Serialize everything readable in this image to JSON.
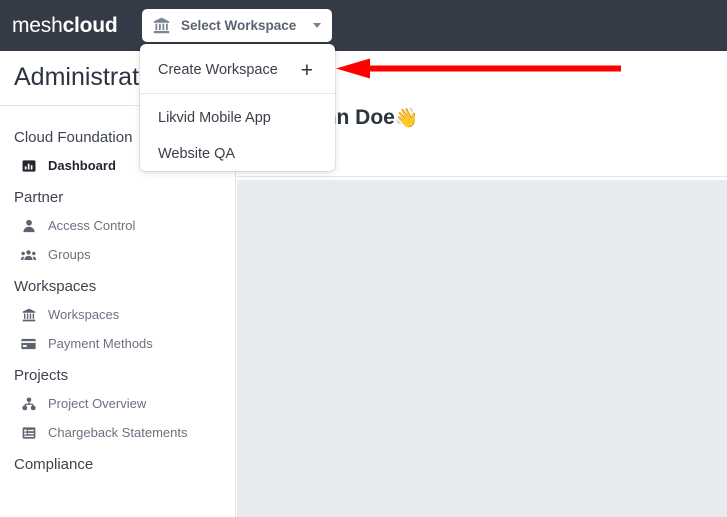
{
  "topbar": {
    "logo_primary": "mesh",
    "logo_secondary": "cloud",
    "workspace_selector": {
      "label": "Select Workspace",
      "icon": "bank-icon",
      "caret_icon": "chevron-down-icon"
    }
  },
  "workspace_dropdown": {
    "create_label": "Create Workspace",
    "create_icon": "plus-icon",
    "workspaces": [
      {
        "label": "Likvid Mobile App"
      },
      {
        "label": "Website QA"
      }
    ]
  },
  "sidebar": {
    "page_title": "Administration",
    "sections": [
      {
        "title": "Cloud Foundation",
        "items": [
          {
            "label": "Dashboard",
            "icon": "chart-bar-icon",
            "active": true
          }
        ]
      },
      {
        "title": "Partner",
        "items": [
          {
            "label": "Access Control",
            "icon": "user-icon",
            "active": false
          },
          {
            "label": "Groups",
            "icon": "users-group-icon",
            "active": false
          }
        ]
      },
      {
        "title": "Workspaces",
        "items": [
          {
            "label": "Workspaces",
            "icon": "bank-icon",
            "active": false
          },
          {
            "label": "Payment Methods",
            "icon": "credit-card-icon",
            "active": false
          }
        ]
      },
      {
        "title": "Projects",
        "items": [
          {
            "label": "Project Overview",
            "icon": "project-nodes-icon",
            "active": false
          },
          {
            "label": "Chargeback Statements",
            "icon": "list-table-icon",
            "active": false
          }
        ]
      },
      {
        "title": "Compliance",
        "items": []
      }
    ]
  },
  "main": {
    "welcome_text": "Welcome back, John Doe",
    "welcome_emoji": "👋"
  },
  "annotation": {
    "arrow_color": "#ff0000",
    "arrow_direction": "left",
    "points_to": "Create Workspace"
  },
  "colors": {
    "topbar_bg": "#353b46",
    "sidebar_bg": "#ffffff",
    "content_panel_bg": "#e8ebee",
    "accent_text": "#2d3440",
    "muted_text": "#6a7280"
  }
}
